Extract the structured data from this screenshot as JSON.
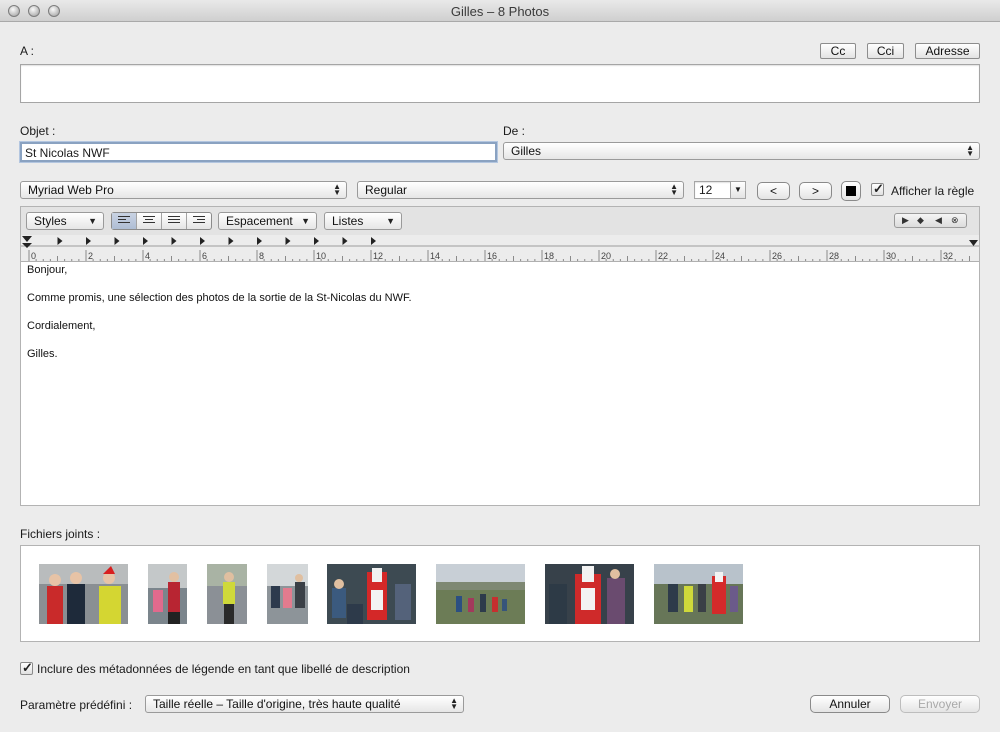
{
  "window": {
    "title": "Gilles  – 8 Photos"
  },
  "to": {
    "label": "A :",
    "value": ""
  },
  "buttons": {
    "cc": "Cc",
    "cci": "Cci",
    "address": "Adresse",
    "cancel": "Annuler",
    "send": "Envoyer"
  },
  "subject": {
    "label": "Objet :",
    "value": "St Nicolas NWF"
  },
  "from": {
    "label": "De :",
    "value": "Gilles"
  },
  "format": {
    "font": "Myriad Web Pro",
    "style": "Regular",
    "size": "12",
    "decrease": "<",
    "increase": ">",
    "show_ruler_label": "Afficher la règle",
    "show_ruler_checked": true
  },
  "toolbar": {
    "styles": "Styles",
    "spacing": "Espacement",
    "lists": "Listes",
    "alignment_selected": "left"
  },
  "ruler": {
    "labels": [
      "0",
      "2",
      "4",
      "6",
      "8",
      "10",
      "12",
      "14",
      "16",
      "18",
      "20",
      "22",
      "24",
      "26",
      "28",
      "30",
      "32"
    ]
  },
  "body": {
    "line1": "Bonjour,",
    "line2": "Comme promis, une sélection des photos de la sortie de la St-Nicolas du NWF.",
    "line3": "Cordialement,",
    "line4": "Gilles."
  },
  "attachments": {
    "label": "Fichiers joints :",
    "photos": [
      {
        "desc": "group-in-red-jackets"
      },
      {
        "desc": "child-in-pink"
      },
      {
        "desc": "man-in-yellow-vest"
      },
      {
        "desc": "family-walking"
      },
      {
        "desc": "saint-nicolas-crowd"
      },
      {
        "desc": "hillside-walkers"
      },
      {
        "desc": "saint-nicolas-close"
      },
      {
        "desc": "field-group"
      }
    ]
  },
  "metadata": {
    "label": "Inclure des métadonnées de légende en tant que libellé de description",
    "checked": true
  },
  "preset": {
    "label": "Paramètre prédéfini :",
    "value": "Taille réelle – Taille d'origine, très haute qualité"
  }
}
